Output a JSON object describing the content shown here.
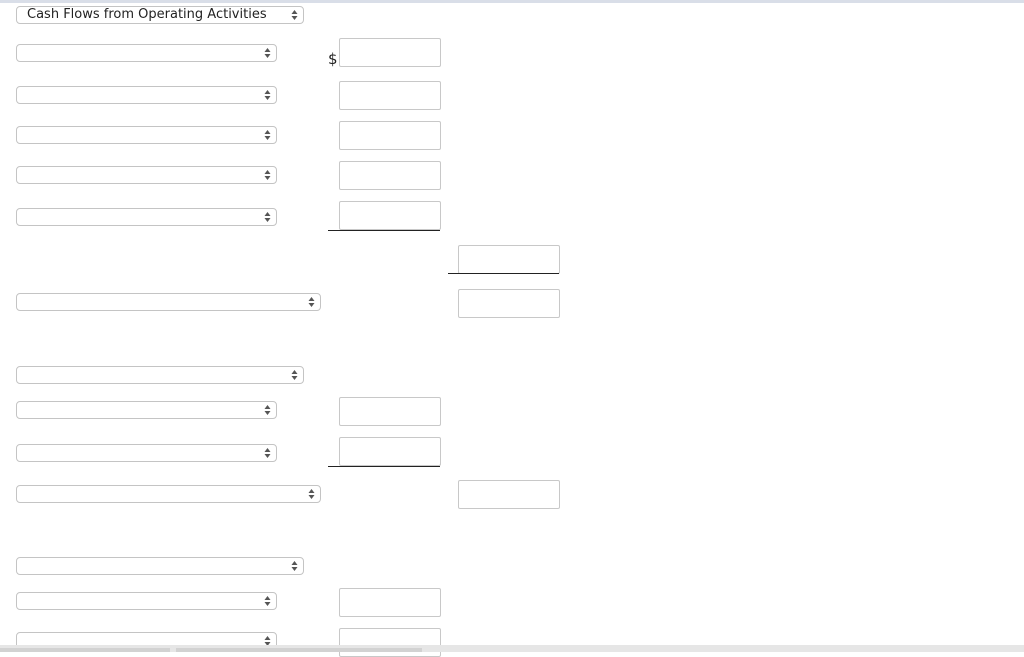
{
  "section_select": {
    "value": "Cash Flows from Operating Activities"
  },
  "currency_symbol": "$",
  "selects": [
    {
      "id": "row1",
      "value": ""
    },
    {
      "id": "row2",
      "value": ""
    },
    {
      "id": "row3",
      "value": ""
    },
    {
      "id": "row4",
      "value": ""
    },
    {
      "id": "row5",
      "value": ""
    },
    {
      "id": "row6",
      "value": ""
    },
    {
      "id": "row7",
      "value": ""
    },
    {
      "id": "row8",
      "value": ""
    },
    {
      "id": "row9",
      "value": ""
    },
    {
      "id": "row10",
      "value": ""
    },
    {
      "id": "row11",
      "value": ""
    },
    {
      "id": "row12",
      "value": ""
    },
    {
      "id": "row13",
      "value": ""
    }
  ],
  "inputs": {
    "col1": [
      "",
      "",
      "",
      "",
      "",
      "",
      "",
      "",
      ""
    ],
    "col2": [
      "",
      "",
      ""
    ]
  },
  "icons": {
    "select_arrow": "up-down-arrows-icon"
  }
}
